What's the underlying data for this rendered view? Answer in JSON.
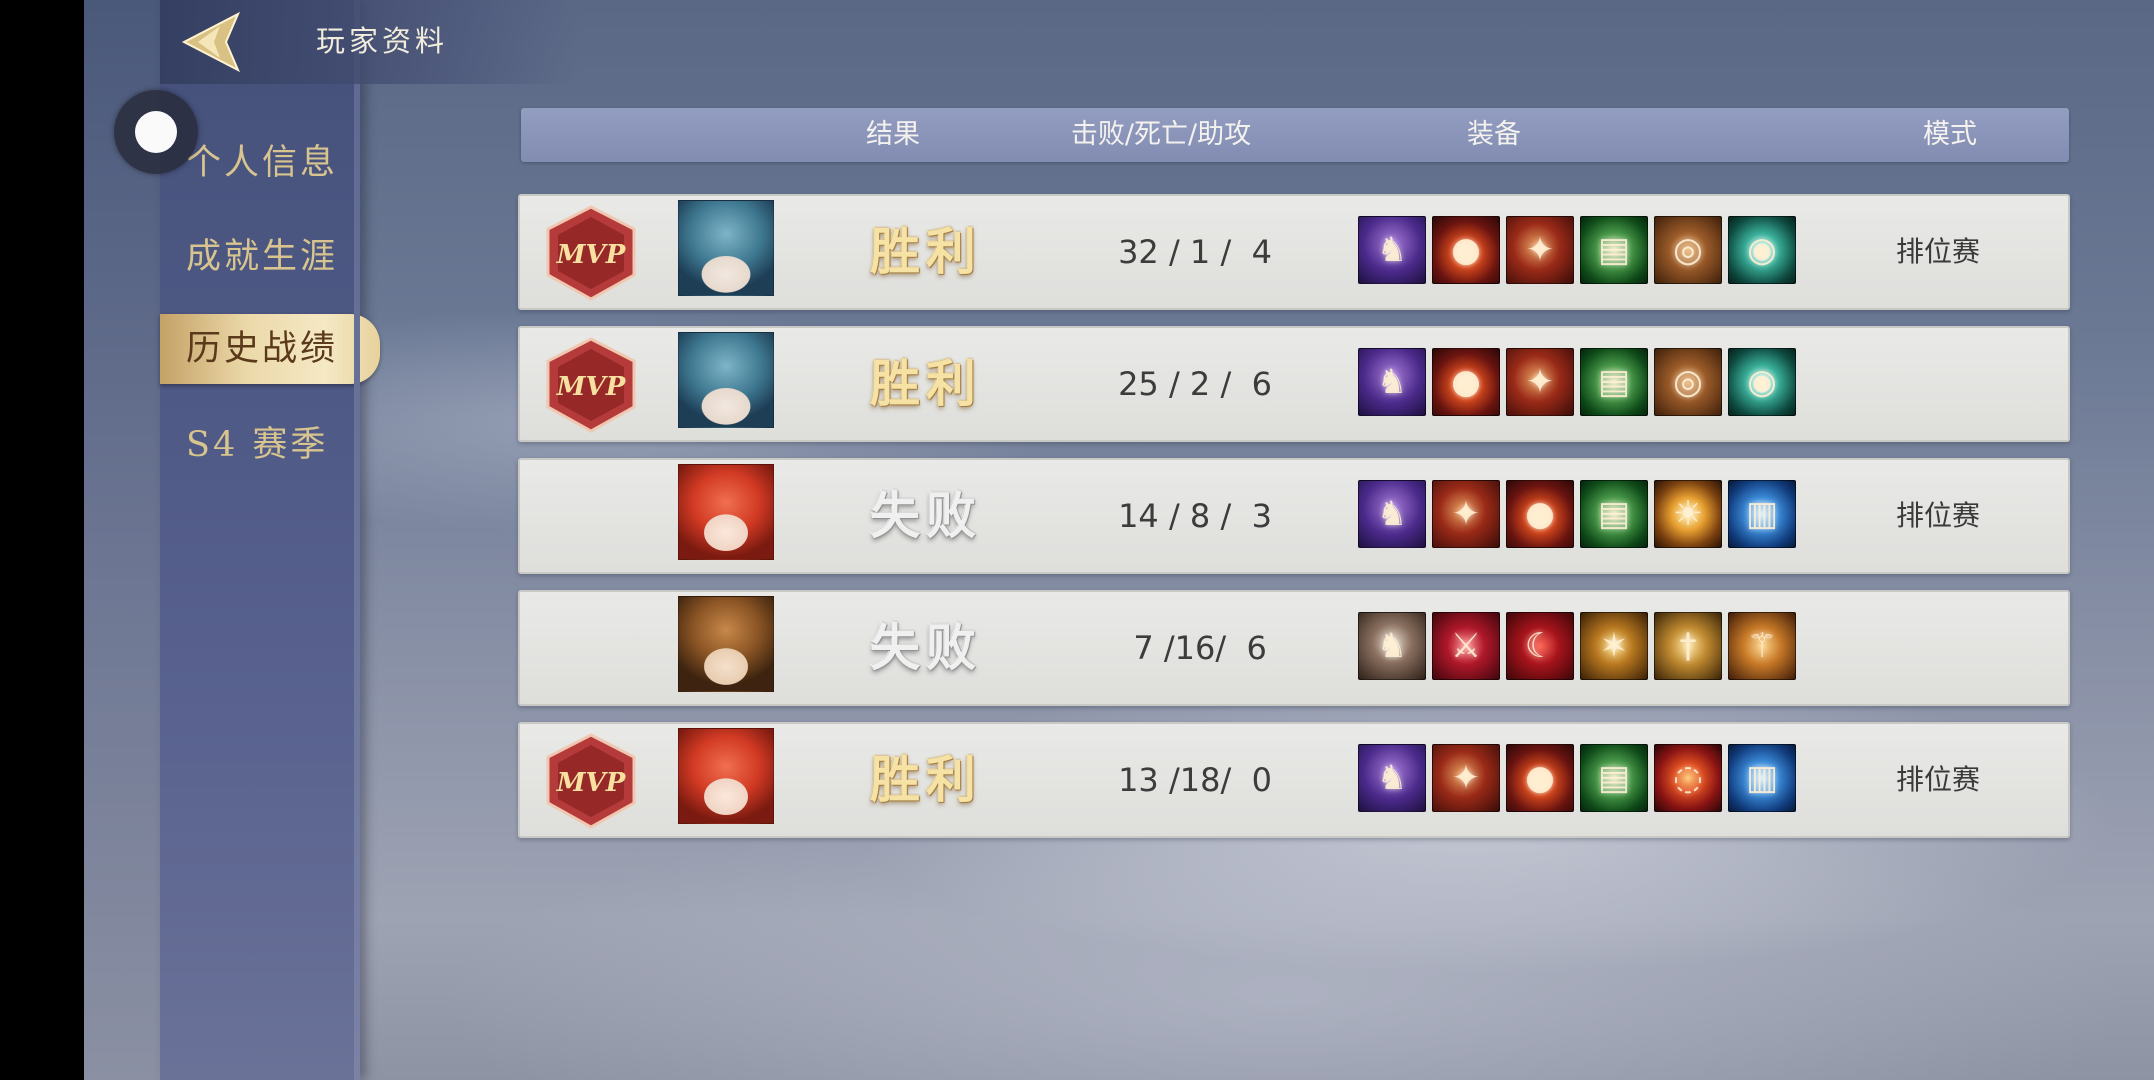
{
  "header": {
    "title": "玩家资料"
  },
  "sidebar": {
    "items": [
      {
        "label": "个人信息"
      },
      {
        "label": "成就生涯"
      },
      {
        "label": "历史战绩"
      },
      {
        "label": "S4 赛季"
      }
    ],
    "active_index": 2
  },
  "table": {
    "columns": [
      "结果",
      "击败/死亡/助攻",
      "装备",
      "模式"
    ]
  },
  "matches": [
    {
      "mvp": true,
      "mvp_label": "MVP",
      "hero_avatar": "blue-haired-hero",
      "result": "胜利",
      "outcome": "win",
      "kda": "32 / 1 /  4",
      "mode": "排位赛",
      "items": [
        "purple-boots-icon",
        "fire-orb-icon",
        "red-scroll-icon",
        "green-tome-icon",
        "bronze-shield-icon",
        "teal-ring-icon"
      ]
    },
    {
      "mvp": true,
      "mvp_label": "MVP",
      "hero_avatar": "blue-haired-hero",
      "result": "胜利",
      "outcome": "win",
      "kda": "25 / 2 /  6",
      "mode": "",
      "items": [
        "purple-boots-icon",
        "fire-orb-icon",
        "red-scroll-icon",
        "green-tome-icon",
        "bronze-shield-icon",
        "teal-ring-icon"
      ]
    },
    {
      "mvp": false,
      "hero_avatar": "red-haired-hero",
      "result": "失败",
      "outcome": "loss",
      "kda": "14 / 8 /  3",
      "mode": "排位赛",
      "items": [
        "purple-boots-icon",
        "red-scroll-icon",
        "fire-orb-icon",
        "green-tome-icon",
        "golden-orb-icon",
        "blue-book-icon"
      ]
    },
    {
      "mvp": false,
      "hero_avatar": "brown-haired-hero",
      "result": "失败",
      "outcome": "loss",
      "kda": " 7 /16/  6",
      "mode": "",
      "items": [
        "steel-boots-icon",
        "crimson-axe-icon",
        "red-blade-icon",
        "golden-claw-icon",
        "golden-sword-icon",
        "golden-spear-icon"
      ]
    },
    {
      "mvp": true,
      "mvp_label": "MVP",
      "hero_avatar": "red-haired-hero",
      "result": "胜利",
      "outcome": "win",
      "kda": "13 /18/  0",
      "mode": "排位赛",
      "items": [
        "purple-boots-icon",
        "red-scroll-icon",
        "fire-orb-icon",
        "green-tome-icon",
        "red-vortex-icon",
        "blue-book-icon"
      ]
    }
  ],
  "colors": {
    "accent_gold": "#d8c48e",
    "win_text": "#f6e2a4",
    "loss_text": "#f0f0f0",
    "row_bg": "#e4e4e2",
    "header_bar": "#8c96bc"
  }
}
